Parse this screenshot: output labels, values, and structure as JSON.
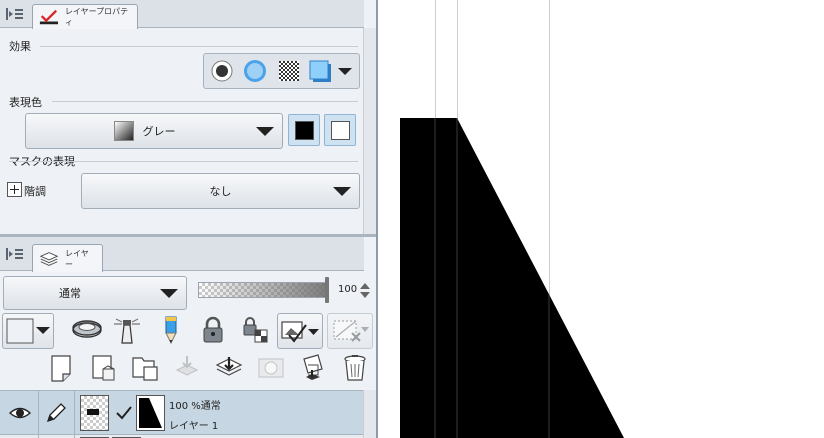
{
  "layer_property_panel": {
    "tab_label": "レイヤープロパティ",
    "effect": {
      "label": "効果",
      "icons": [
        "border-effect-icon",
        "watercolor-edge-icon",
        "tone-icon",
        "layer-color-icon"
      ]
    },
    "expression_color": {
      "label": "表現色",
      "selected": "グレー",
      "main_color": "#000000",
      "sub_color": "#ffffff"
    },
    "mask_expression": {
      "label": "マスクの表現",
      "gradation_label": "階調",
      "selected": "なし"
    }
  },
  "layer_panel": {
    "tab_label": "レイヤー",
    "blend_mode": "通常",
    "opacity_value": "100",
    "opacity_fraction": 1.0,
    "layers": [
      {
        "blend_info": "100 %通常",
        "name": "レイヤー 1",
        "visible": true,
        "selected": true
      }
    ]
  },
  "colors": {
    "panel_bg": "#eef1f5",
    "accent_blue": "#cfe2f2",
    "selected_row": "#c6d6e2",
    "canvas_fill": "#000000"
  }
}
